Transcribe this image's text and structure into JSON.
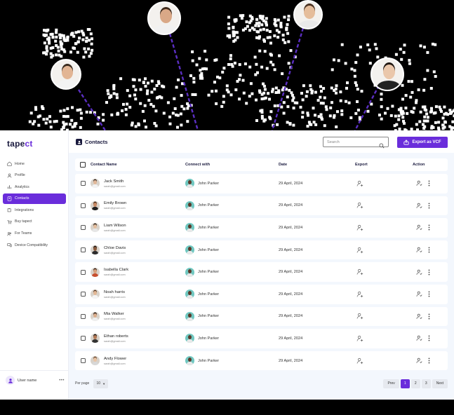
{
  "brand": {
    "name_main": "tape",
    "name_accent": "ct",
    "accent": "#6a2ddb"
  },
  "sidebar": {
    "items": [
      {
        "label": "Home",
        "icon": "home-icon",
        "active": false
      },
      {
        "label": "Profile",
        "icon": "user-icon",
        "active": false
      },
      {
        "label": "Analytics",
        "icon": "bar-chart-icon",
        "active": false
      },
      {
        "label": "Contacts",
        "icon": "contacts-icon",
        "active": true
      },
      {
        "label": "Integrations",
        "icon": "puzzle-icon",
        "active": false
      },
      {
        "label": "Buy tapect",
        "icon": "cart-icon",
        "active": false
      },
      {
        "label": "For Teams",
        "icon": "team-icon",
        "active": false
      },
      {
        "label": "Device Compatibility",
        "icon": "devices-icon",
        "active": false
      }
    ],
    "user_name": "User name",
    "user_more": "•••"
  },
  "header": {
    "title": "Contacts",
    "search_placeholder": "Search",
    "export_label": "Export as VCF"
  },
  "table": {
    "columns": [
      "Contact Name",
      "Connect with",
      "Date",
      "Export",
      "Action"
    ],
    "rows": [
      {
        "name": "Jack Smith",
        "email": "sarah@gmail.com",
        "connect": "John Parker",
        "date": "29 April, 2024",
        "skin": "#e2b899",
        "hair": "#3a2b20",
        "shirt": "#f2f2f2"
      },
      {
        "name": "Emily Brown",
        "email": "sarah@gmail.com",
        "connect": "John Parker",
        "date": "29 April, 2024",
        "skin": "#c98a64",
        "hair": "#4a2a18",
        "shirt": "#1f1f1f"
      },
      {
        "name": "Liam Wilson",
        "email": "sarah@gmail.com",
        "connect": "John Parker",
        "date": "29 April, 2024",
        "skin": "#e4bf9f",
        "hair": "#2c2018",
        "shirt": "#e6e6e6"
      },
      {
        "name": "Chloe Davis",
        "email": "sarah@gmail.com",
        "connect": "John Parker",
        "date": "29 April, 2024",
        "skin": "#8a5a3c",
        "hair": "#1c1410",
        "shirt": "#2b2b2b"
      },
      {
        "name": "Isabella Clark",
        "email": "sarah@gmail.com",
        "connect": "John Parker",
        "date": "29 April, 2024",
        "skin": "#d6a07b",
        "hair": "#3b2418",
        "shirt": "#c74f2e"
      },
      {
        "name": "Noah harris",
        "email": "sarah@gmail.com",
        "connect": "John Parker",
        "date": "29 April, 2024",
        "skin": "#e3b896",
        "hair": "#5a3a24",
        "shirt": "#f4f4f4"
      },
      {
        "name": "Mia Walker",
        "email": "sarah@gmail.com",
        "connect": "John Parker",
        "date": "29 April, 2024",
        "skin": "#dcae8c",
        "hair": "#2a1b14",
        "shirt": "#efefef"
      },
      {
        "name": "Ethan roberts",
        "email": "sarah@gmail.com",
        "connect": "John Parker",
        "date": "29 April, 2024",
        "skin": "#b47a56",
        "hair": "#1a1410",
        "shirt": "#333333"
      },
      {
        "name": "Andy Flower",
        "email": "sarah@gmail.com",
        "connect": "John Parker",
        "date": "29 April, 2024",
        "skin": "#e8c3a4",
        "hair": "#6b4a32",
        "shirt": "#d8d8d8"
      }
    ]
  },
  "pagination": {
    "per_page_label": "Per page",
    "per_page_value": "10",
    "prev_label": "Prev",
    "pages": [
      "1",
      "2",
      "3"
    ],
    "active_page": "1",
    "next_label": "Next"
  },
  "hero_people": [
    {
      "label": "person-1",
      "skin": "#e2b594",
      "hair": "#3a2b1f",
      "shirt": "#f3f3f3"
    },
    {
      "label": "person-2",
      "skin": "#d9a887",
      "hair": "#3e2a1c",
      "shirt": "#f1f1f1"
    },
    {
      "label": "person-3",
      "skin": "#e5bd9b",
      "hair": "#4a3222",
      "shirt": "#e9e9e9"
    },
    {
      "label": "person-4",
      "skin": "#eac7ab",
      "hair": "#1e1510",
      "shirt": "#222222"
    }
  ]
}
